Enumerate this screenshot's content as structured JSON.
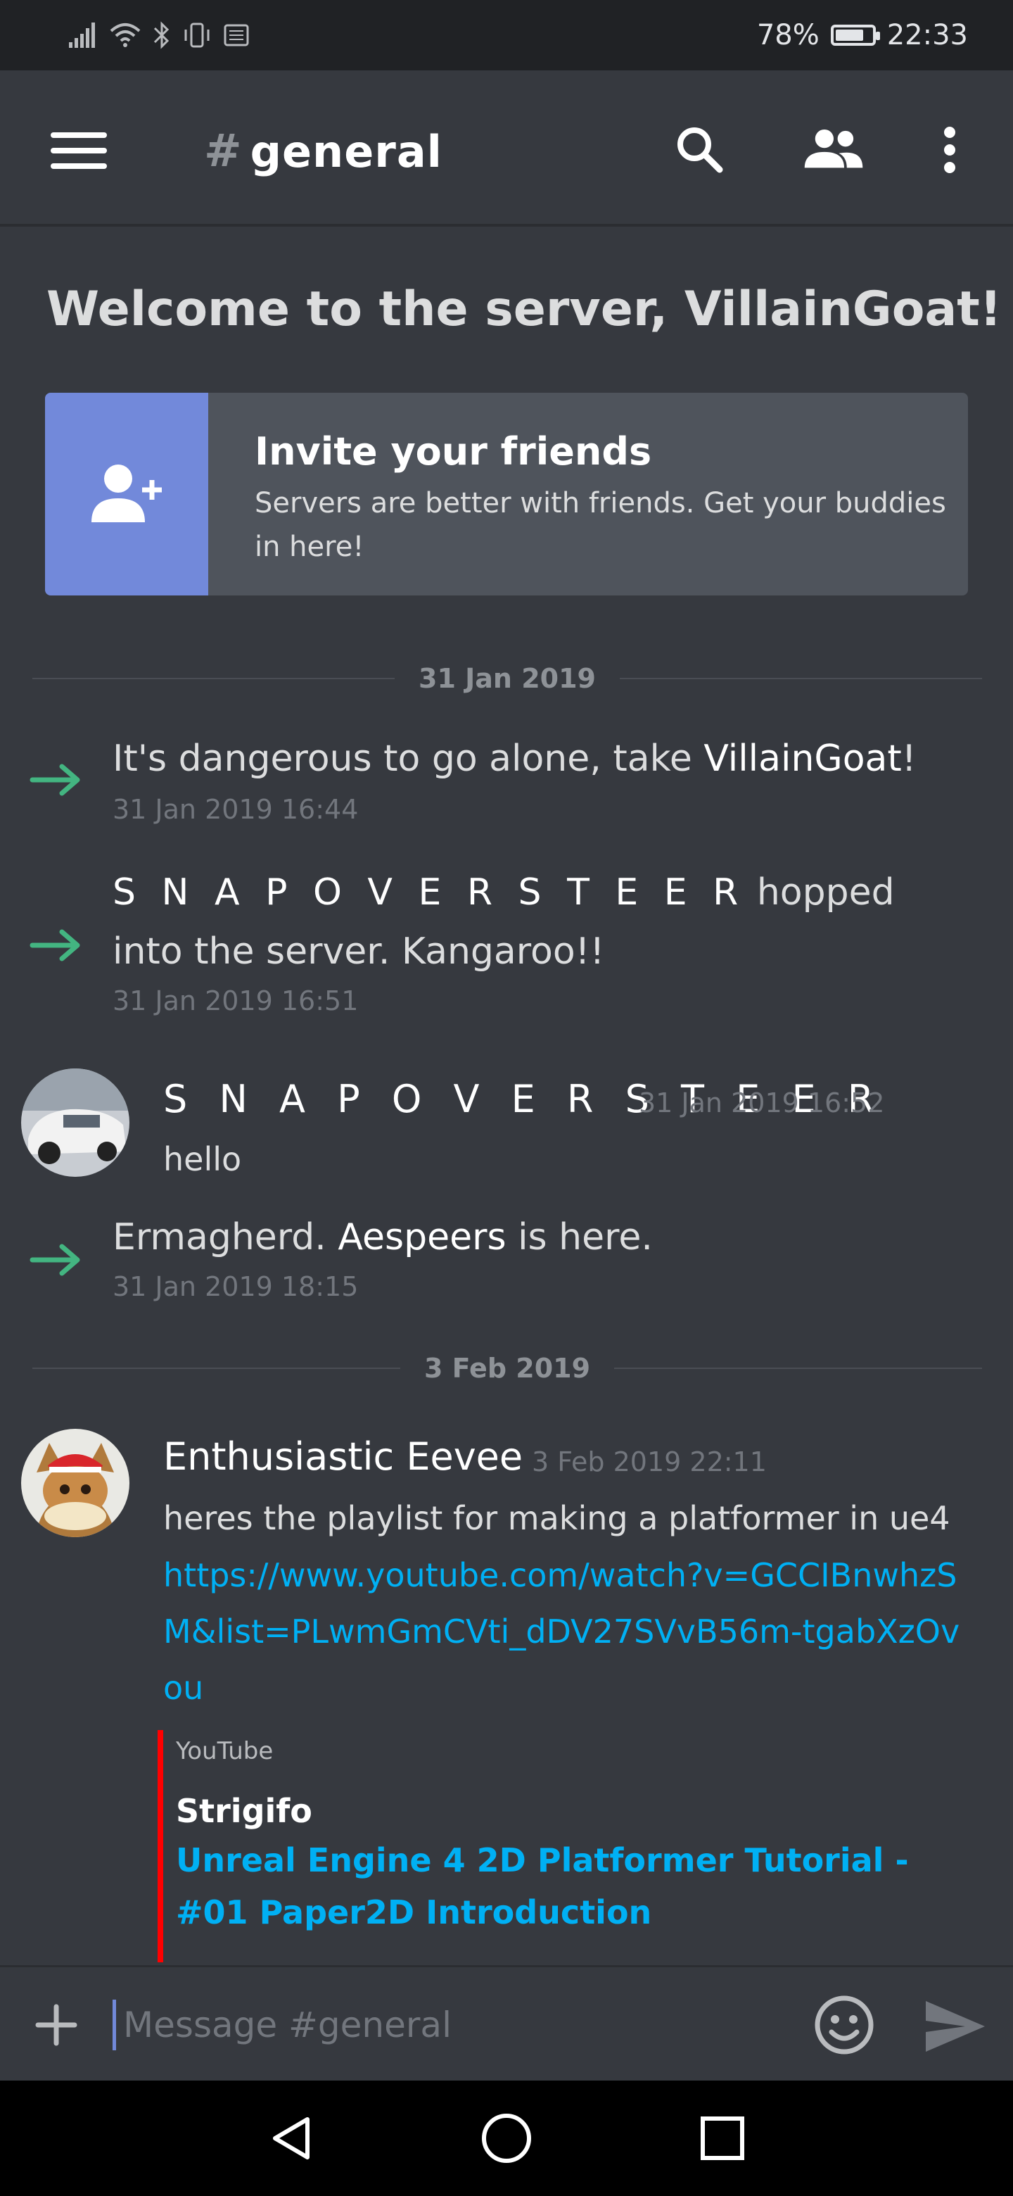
{
  "status_bar": {
    "battery_percent": "78%",
    "battery_level": 0.78,
    "time": "22:33",
    "left_icons": [
      "signal-icon",
      "wifi-icon",
      "bluetooth-icon",
      "vibrate-icon",
      "sim-icon"
    ]
  },
  "header": {
    "hash": "#",
    "channel_name": "general",
    "icons": [
      "hamburger-menu-icon",
      "search-icon",
      "members-icon",
      "more-vertical-icon"
    ]
  },
  "welcome": {
    "title": "Welcome to the server, VillainGoat!"
  },
  "invite": {
    "title": "Invite your friends",
    "subtitle": "Servers are better with friends. Get your buddies in here!"
  },
  "separators": [
    "31 Jan 2019",
    "3 Feb 2019"
  ],
  "messages": {
    "sys1": {
      "prefix": "It's dangerous to go alone, take ",
      "name": "VillainGoat",
      "suffix": "!",
      "time": "31 Jan 2019 16:44"
    },
    "sys2": {
      "name": "S N A P O V E R S T E E R",
      "suffix": " hopped into the server. Kangaroo!!",
      "time": "31 Jan 2019 16:51"
    },
    "user1": {
      "name": "S N A P O V E R S T E E R",
      "time": "31 Jan 2019 16:52",
      "text": "hello"
    },
    "sys3": {
      "prefix": "Ermagherd. ",
      "name": "Aespeers",
      "suffix": " is here.",
      "time": "31 Jan 2019 18:15"
    },
    "user2": {
      "name": "Enthusiastic Eevee",
      "time": "3 Feb 2019 22:11",
      "text": "heres the playlist for making a platformer in ue4",
      "link": "https://www.youtube.com/watch?v=GCCIBnwhzSM&list=PLwmGmCVti_dDV27SVvB56m-tgabXzOvou"
    }
  },
  "embed": {
    "provider": "YouTube",
    "author": "Strigifo",
    "title": "Unreal Engine 4 2D Platformer Tutorial - #01 Paper2D Introduction",
    "accent_color": "#ff0000"
  },
  "composer": {
    "placeholder": "Message #general"
  },
  "colors": {
    "background": "#36393f",
    "blurple": "#7289da",
    "link": "#00b0f4",
    "join_arrow": "#43b581"
  }
}
